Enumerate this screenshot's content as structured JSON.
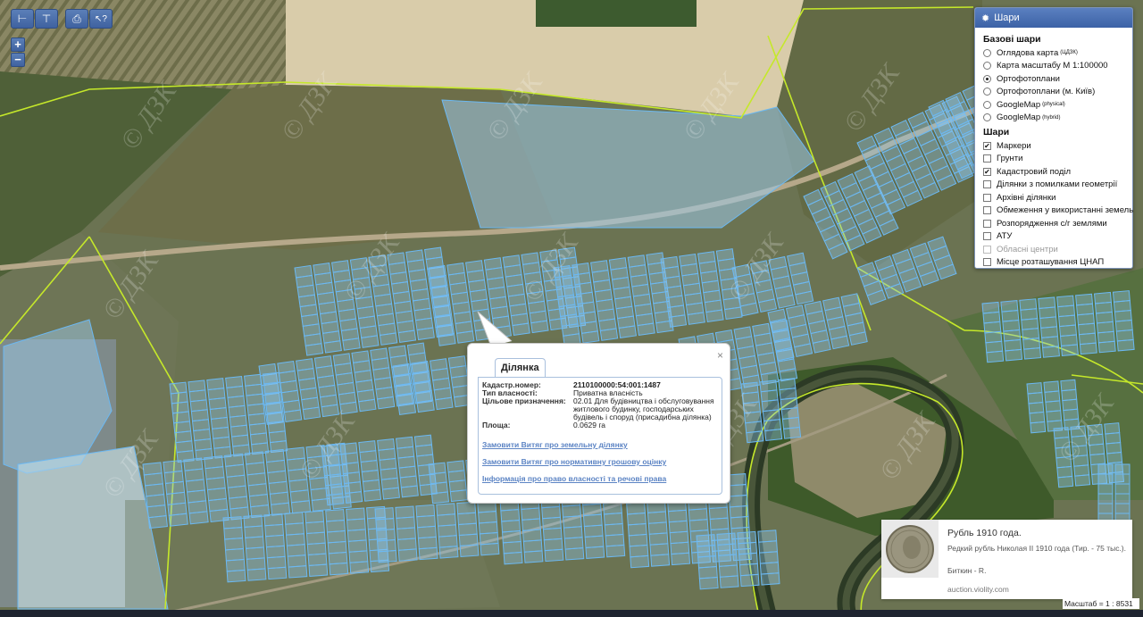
{
  "toolbar": {
    "buttons": [
      {
        "name": "measure-distance-icon",
        "glyph": "⊢"
      },
      {
        "name": "measure-area-icon",
        "glyph": "⊤"
      },
      {
        "name": "print-icon",
        "glyph": "⎙"
      },
      {
        "name": "info-cursor-icon",
        "glyph": "↖?"
      }
    ]
  },
  "zoom": {
    "in": "+",
    "out": "−"
  },
  "watermark": "© ДЗК",
  "layers_panel": {
    "title": "Шари",
    "base_title": "Базові шари",
    "base": [
      {
        "label": "Оглядова карта",
        "sup": "(ЦДЗК)",
        "selected": false
      },
      {
        "label": "Карта масштабу М 1:100000",
        "sup": "",
        "selected": false
      },
      {
        "label": "Ортофотоплани",
        "sup": "",
        "selected": true
      },
      {
        "label": "Ортофотоплани (м. Київ)",
        "sup": "",
        "selected": false
      },
      {
        "label": "GoogleMap",
        "sup": "(physical)",
        "selected": false
      },
      {
        "label": "GoogleMap",
        "sup": "(hybrid)",
        "selected": false
      }
    ],
    "overlay_title": "Шари",
    "overlays": [
      {
        "label": "Маркери",
        "checked": true,
        "disabled": false
      },
      {
        "label": "Грунти",
        "checked": false,
        "disabled": false
      },
      {
        "label": "Кадастровий поділ",
        "checked": true,
        "disabled": false
      },
      {
        "label": "Ділянки з помилками геометрії",
        "checked": false,
        "disabled": false
      },
      {
        "label": "Архівні ділянки",
        "checked": false,
        "disabled": false
      },
      {
        "label": "Обмеження у використанні земель",
        "checked": false,
        "disabled": false
      },
      {
        "label": "Розпорядження с/г землями",
        "checked": false,
        "disabled": false
      },
      {
        "label": "АТУ",
        "checked": false,
        "disabled": false
      },
      {
        "label": "Обласні центри",
        "checked": false,
        "disabled": true
      },
      {
        "label": "Місце розташування ЦНАП",
        "checked": false,
        "disabled": false
      }
    ]
  },
  "popup": {
    "close": "×",
    "tab": "Ділянка",
    "fields": [
      {
        "key": "Кадастр.номер:",
        "value": "2110100000:54:001:1487",
        "bold": true
      },
      {
        "key": "Тип власності:",
        "value": "Приватна власність",
        "bold": false
      },
      {
        "key": "Цільове призначення:",
        "value": "02.01 Для будівництва і обслуговування житлового будинку, господарських будівель і споруд (присадибна ділянка)",
        "bold": false
      },
      {
        "key": "Площа:",
        "value": "0.0629 га",
        "bold": false
      }
    ],
    "links": [
      "Замовити Витяг про земельну ділянку",
      "Замовити Витяг про нормативну грошову оцінку",
      "Інформація про право власності та речові права"
    ]
  },
  "ad": {
    "title": "Рубль 1910 года.",
    "text": "Редкий рубль Николая II 1910 года (Тир. - 75 тыс.).",
    "author": "Биткин - R.",
    "url": "auction.violity.com"
  },
  "scale": "Масштаб = 1 : 8531",
  "colors": {
    "parcel_fill": "#8fc8f0",
    "parcel_stroke": "#6bb8f2",
    "boundary": "#c5e82a",
    "header": "#4a71b4"
  }
}
